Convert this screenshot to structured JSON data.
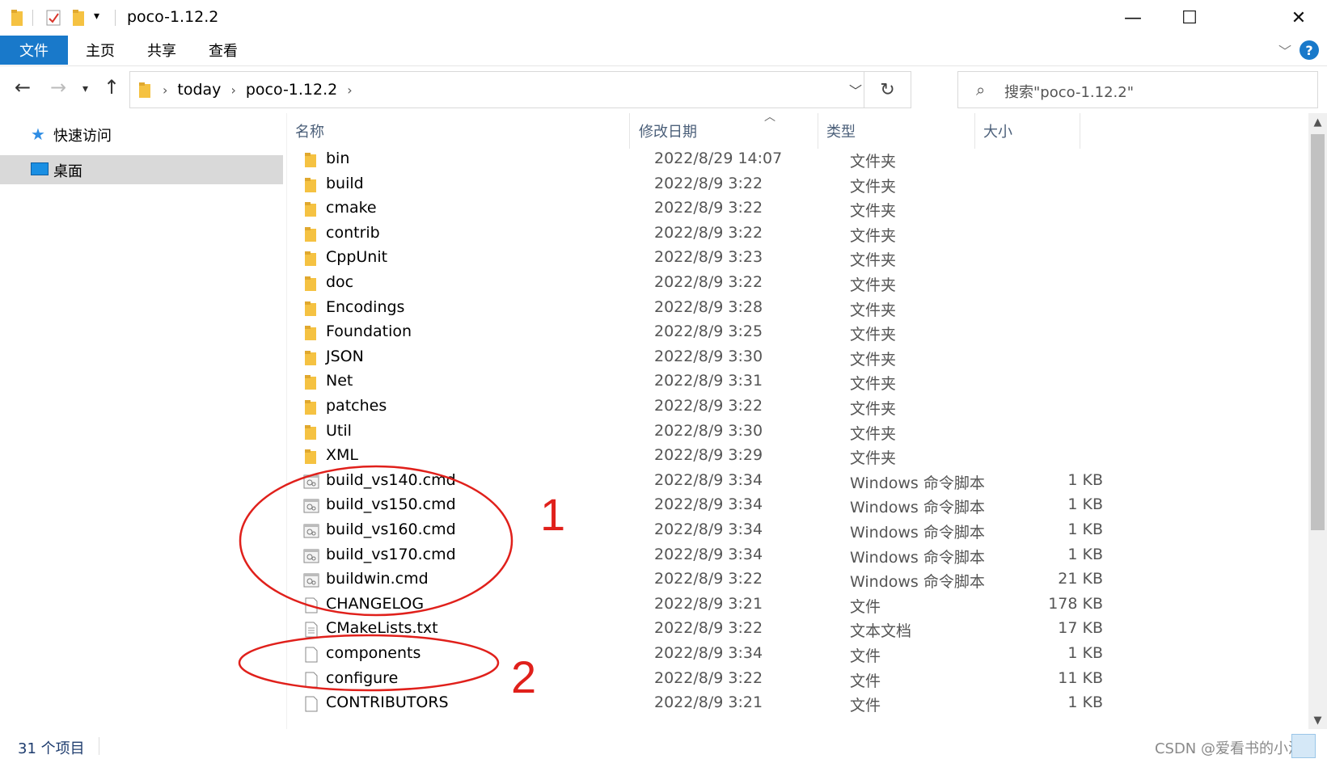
{
  "window": {
    "title": "poco-1.12.2",
    "controls": {
      "minimize": "—",
      "maximize": "☐",
      "close": "✕"
    }
  },
  "ribbon": {
    "tabs": [
      "文件",
      "主页",
      "共享",
      "查看"
    ],
    "help": "?"
  },
  "address": {
    "crumbs": [
      "today",
      "poco-1.12.2"
    ],
    "search_placeholder": "搜索\"poco-1.12.2\""
  },
  "navpane": {
    "items": [
      {
        "label": "快速访问",
        "icon": "star-icon"
      },
      {
        "label": "桌面",
        "icon": "desktop-icon",
        "selected": true
      }
    ]
  },
  "columns": {
    "name": "名称",
    "date": "修改日期",
    "type": "类型",
    "size": "大小"
  },
  "files": [
    {
      "name": "bin",
      "date": "2022/8/29 14:07",
      "type": "文件夹",
      "size": "",
      "icon": "folder-icon"
    },
    {
      "name": "build",
      "date": "2022/8/9 3:22",
      "type": "文件夹",
      "size": "",
      "icon": "folder-icon"
    },
    {
      "name": "cmake",
      "date": "2022/8/9 3:22",
      "type": "文件夹",
      "size": "",
      "icon": "folder-icon"
    },
    {
      "name": "contrib",
      "date": "2022/8/9 3:22",
      "type": "文件夹",
      "size": "",
      "icon": "folder-icon"
    },
    {
      "name": "CppUnit",
      "date": "2022/8/9 3:23",
      "type": "文件夹",
      "size": "",
      "icon": "folder-icon"
    },
    {
      "name": "doc",
      "date": "2022/8/9 3:22",
      "type": "文件夹",
      "size": "",
      "icon": "folder-icon"
    },
    {
      "name": "Encodings",
      "date": "2022/8/9 3:28",
      "type": "文件夹",
      "size": "",
      "icon": "folder-icon"
    },
    {
      "name": "Foundation",
      "date": "2022/8/9 3:25",
      "type": "文件夹",
      "size": "",
      "icon": "folder-icon"
    },
    {
      "name": "JSON",
      "date": "2022/8/9 3:30",
      "type": "文件夹",
      "size": "",
      "icon": "folder-icon"
    },
    {
      "name": "Net",
      "date": "2022/8/9 3:31",
      "type": "文件夹",
      "size": "",
      "icon": "folder-icon"
    },
    {
      "name": "patches",
      "date": "2022/8/9 3:22",
      "type": "文件夹",
      "size": "",
      "icon": "folder-icon"
    },
    {
      "name": "Util",
      "date": "2022/8/9 3:30",
      "type": "文件夹",
      "size": "",
      "icon": "folder-icon"
    },
    {
      "name": "XML",
      "date": "2022/8/9 3:29",
      "type": "文件夹",
      "size": "",
      "icon": "folder-icon"
    },
    {
      "name": "build_vs140.cmd",
      "date": "2022/8/9 3:34",
      "type": "Windows 命令脚本",
      "size": "1 KB",
      "icon": "cmd-file-icon"
    },
    {
      "name": "build_vs150.cmd",
      "date": "2022/8/9 3:34",
      "type": "Windows 命令脚本",
      "size": "1 KB",
      "icon": "cmd-file-icon"
    },
    {
      "name": "build_vs160.cmd",
      "date": "2022/8/9 3:34",
      "type": "Windows 命令脚本",
      "size": "1 KB",
      "icon": "cmd-file-icon"
    },
    {
      "name": "build_vs170.cmd",
      "date": "2022/8/9 3:34",
      "type": "Windows 命令脚本",
      "size": "1 KB",
      "icon": "cmd-file-icon"
    },
    {
      "name": "buildwin.cmd",
      "date": "2022/8/9 3:22",
      "type": "Windows 命令脚本",
      "size": "21 KB",
      "icon": "cmd-file-icon"
    },
    {
      "name": "CHANGELOG",
      "date": "2022/8/9 3:21",
      "type": "文件",
      "size": "178 KB",
      "icon": "file-icon"
    },
    {
      "name": "CMakeLists.txt",
      "date": "2022/8/9 3:22",
      "type": "文本文档",
      "size": "17 KB",
      "icon": "text-file-icon"
    },
    {
      "name": "components",
      "date": "2022/8/9 3:34",
      "type": "文件",
      "size": "1 KB",
      "icon": "file-icon"
    },
    {
      "name": "configure",
      "date": "2022/8/9 3:22",
      "type": "文件",
      "size": "11 KB",
      "icon": "file-icon"
    },
    {
      "name": "CONTRIBUTORS",
      "date": "2022/8/9 3:21",
      "type": "文件",
      "size": "1 KB",
      "icon": "file-icon"
    }
  ],
  "status": {
    "count": "31 个项目"
  },
  "watermark": "CSDN @爱看书的小沐",
  "annotations": {
    "label1": "1",
    "label2": "2",
    "color": "#e0201b"
  },
  "colors": {
    "accent": "#1979ca",
    "selected_nav": "#d9d9d9",
    "folder": "#f5c242"
  }
}
